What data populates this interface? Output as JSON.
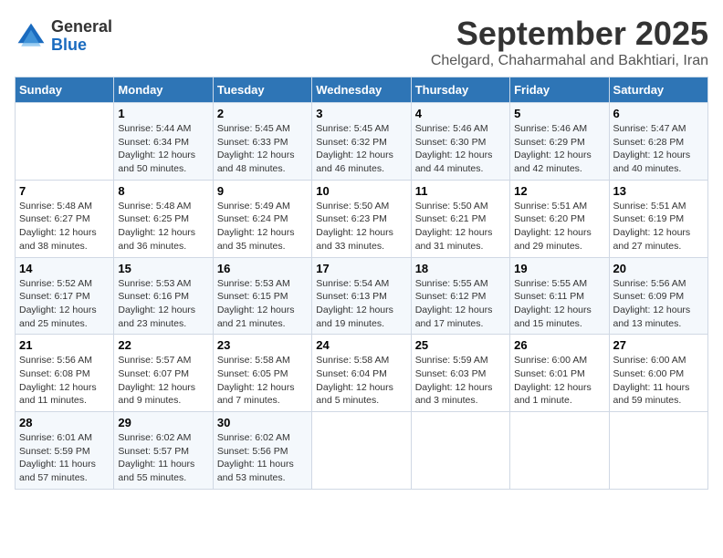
{
  "header": {
    "logo_general": "General",
    "logo_blue": "Blue",
    "month": "September 2025",
    "location": "Chelgard, Chaharmahal and Bakhtiari, Iran"
  },
  "weekdays": [
    "Sunday",
    "Monday",
    "Tuesday",
    "Wednesday",
    "Thursday",
    "Friday",
    "Saturday"
  ],
  "weeks": [
    [
      {
        "day": "",
        "info": ""
      },
      {
        "day": "1",
        "info": "Sunrise: 5:44 AM\nSunset: 6:34 PM\nDaylight: 12 hours\nand 50 minutes."
      },
      {
        "day": "2",
        "info": "Sunrise: 5:45 AM\nSunset: 6:33 PM\nDaylight: 12 hours\nand 48 minutes."
      },
      {
        "day": "3",
        "info": "Sunrise: 5:45 AM\nSunset: 6:32 PM\nDaylight: 12 hours\nand 46 minutes."
      },
      {
        "day": "4",
        "info": "Sunrise: 5:46 AM\nSunset: 6:30 PM\nDaylight: 12 hours\nand 44 minutes."
      },
      {
        "day": "5",
        "info": "Sunrise: 5:46 AM\nSunset: 6:29 PM\nDaylight: 12 hours\nand 42 minutes."
      },
      {
        "day": "6",
        "info": "Sunrise: 5:47 AM\nSunset: 6:28 PM\nDaylight: 12 hours\nand 40 minutes."
      }
    ],
    [
      {
        "day": "7",
        "info": "Sunrise: 5:48 AM\nSunset: 6:27 PM\nDaylight: 12 hours\nand 38 minutes."
      },
      {
        "day": "8",
        "info": "Sunrise: 5:48 AM\nSunset: 6:25 PM\nDaylight: 12 hours\nand 36 minutes."
      },
      {
        "day": "9",
        "info": "Sunrise: 5:49 AM\nSunset: 6:24 PM\nDaylight: 12 hours\nand 35 minutes."
      },
      {
        "day": "10",
        "info": "Sunrise: 5:50 AM\nSunset: 6:23 PM\nDaylight: 12 hours\nand 33 minutes."
      },
      {
        "day": "11",
        "info": "Sunrise: 5:50 AM\nSunset: 6:21 PM\nDaylight: 12 hours\nand 31 minutes."
      },
      {
        "day": "12",
        "info": "Sunrise: 5:51 AM\nSunset: 6:20 PM\nDaylight: 12 hours\nand 29 minutes."
      },
      {
        "day": "13",
        "info": "Sunrise: 5:51 AM\nSunset: 6:19 PM\nDaylight: 12 hours\nand 27 minutes."
      }
    ],
    [
      {
        "day": "14",
        "info": "Sunrise: 5:52 AM\nSunset: 6:17 PM\nDaylight: 12 hours\nand 25 minutes."
      },
      {
        "day": "15",
        "info": "Sunrise: 5:53 AM\nSunset: 6:16 PM\nDaylight: 12 hours\nand 23 minutes."
      },
      {
        "day": "16",
        "info": "Sunrise: 5:53 AM\nSunset: 6:15 PM\nDaylight: 12 hours\nand 21 minutes."
      },
      {
        "day": "17",
        "info": "Sunrise: 5:54 AM\nSunset: 6:13 PM\nDaylight: 12 hours\nand 19 minutes."
      },
      {
        "day": "18",
        "info": "Sunrise: 5:55 AM\nSunset: 6:12 PM\nDaylight: 12 hours\nand 17 minutes."
      },
      {
        "day": "19",
        "info": "Sunrise: 5:55 AM\nSunset: 6:11 PM\nDaylight: 12 hours\nand 15 minutes."
      },
      {
        "day": "20",
        "info": "Sunrise: 5:56 AM\nSunset: 6:09 PM\nDaylight: 12 hours\nand 13 minutes."
      }
    ],
    [
      {
        "day": "21",
        "info": "Sunrise: 5:56 AM\nSunset: 6:08 PM\nDaylight: 12 hours\nand 11 minutes."
      },
      {
        "day": "22",
        "info": "Sunrise: 5:57 AM\nSunset: 6:07 PM\nDaylight: 12 hours\nand 9 minutes."
      },
      {
        "day": "23",
        "info": "Sunrise: 5:58 AM\nSunset: 6:05 PM\nDaylight: 12 hours\nand 7 minutes."
      },
      {
        "day": "24",
        "info": "Sunrise: 5:58 AM\nSunset: 6:04 PM\nDaylight: 12 hours\nand 5 minutes."
      },
      {
        "day": "25",
        "info": "Sunrise: 5:59 AM\nSunset: 6:03 PM\nDaylight: 12 hours\nand 3 minutes."
      },
      {
        "day": "26",
        "info": "Sunrise: 6:00 AM\nSunset: 6:01 PM\nDaylight: 12 hours\nand 1 minute."
      },
      {
        "day": "27",
        "info": "Sunrise: 6:00 AM\nSunset: 6:00 PM\nDaylight: 11 hours\nand 59 minutes."
      }
    ],
    [
      {
        "day": "28",
        "info": "Sunrise: 6:01 AM\nSunset: 5:59 PM\nDaylight: 11 hours\nand 57 minutes."
      },
      {
        "day": "29",
        "info": "Sunrise: 6:02 AM\nSunset: 5:57 PM\nDaylight: 11 hours\nand 55 minutes."
      },
      {
        "day": "30",
        "info": "Sunrise: 6:02 AM\nSunset: 5:56 PM\nDaylight: 11 hours\nand 53 minutes."
      },
      {
        "day": "",
        "info": ""
      },
      {
        "day": "",
        "info": ""
      },
      {
        "day": "",
        "info": ""
      },
      {
        "day": "",
        "info": ""
      }
    ]
  ]
}
